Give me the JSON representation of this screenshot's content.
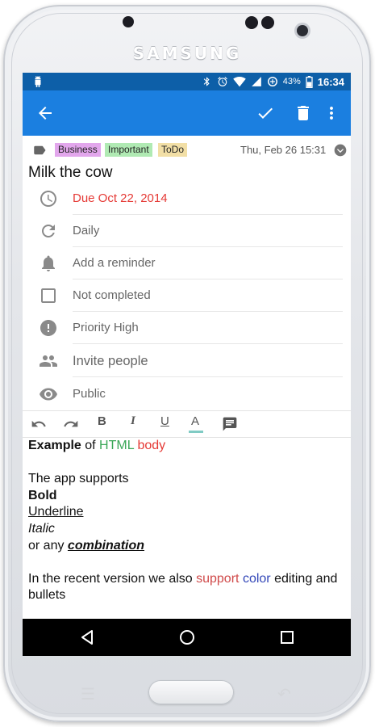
{
  "device": {
    "brand": "SAMSUNG"
  },
  "status_bar": {
    "battery": "43%",
    "time": "16:34",
    "icons": [
      "android-icon",
      "bluetooth-icon",
      "alarm-icon",
      "wifi-icon",
      "signal-icon",
      "data-saver-icon",
      "battery-icon"
    ]
  },
  "app_bar": {
    "icons": [
      "back-arrow-icon",
      "check-icon",
      "trash-icon",
      "more-vert-icon"
    ]
  },
  "tags": [
    {
      "label": "Business",
      "color": "#e2a6ec"
    },
    {
      "label": "Important",
      "color": "#b0eab3"
    },
    {
      "label": "ToDo",
      "color": "#f2dfa6"
    }
  ],
  "created": "Thu, Feb 26 15:31",
  "task": {
    "title": "Milk the cow"
  },
  "fields": [
    {
      "icon": "clock-icon",
      "text": "Due Oct 22, 2014",
      "color": "#e53935"
    },
    {
      "icon": "repeat-icon",
      "text": "Daily"
    },
    {
      "icon": "bell-icon",
      "text": "Add a reminder"
    },
    {
      "icon": "checkbox-icon",
      "text": "Not completed"
    },
    {
      "icon": "priority-icon",
      "text": "Priority High"
    },
    {
      "icon": "people-icon",
      "text": "Invite people"
    },
    {
      "icon": "eye-icon",
      "text": "Public"
    }
  ],
  "editor_toolbar": {
    "bold": "B",
    "italic": "I",
    "underline": "U",
    "text_color": "A",
    "text_color_bar": "#80cbc4"
  },
  "body": {
    "line1": {
      "bold": "Example",
      "of": " of ",
      "html": "HTML",
      "space": " ",
      "body": "body"
    },
    "line2": "The app supports",
    "bold": "Bold",
    "underline": "Underline",
    "italic": "Italic",
    "or_any": "or any ",
    "combination": "combination",
    "recent_pre": "In the recent version we also ",
    "support": "support",
    "color": "color",
    "recent_post": " editing and bullets",
    "colors": {
      "green": "#3aa757",
      "red": "#e53935",
      "red_muted": "#d04a4a",
      "blue": "#3347b8"
    }
  }
}
